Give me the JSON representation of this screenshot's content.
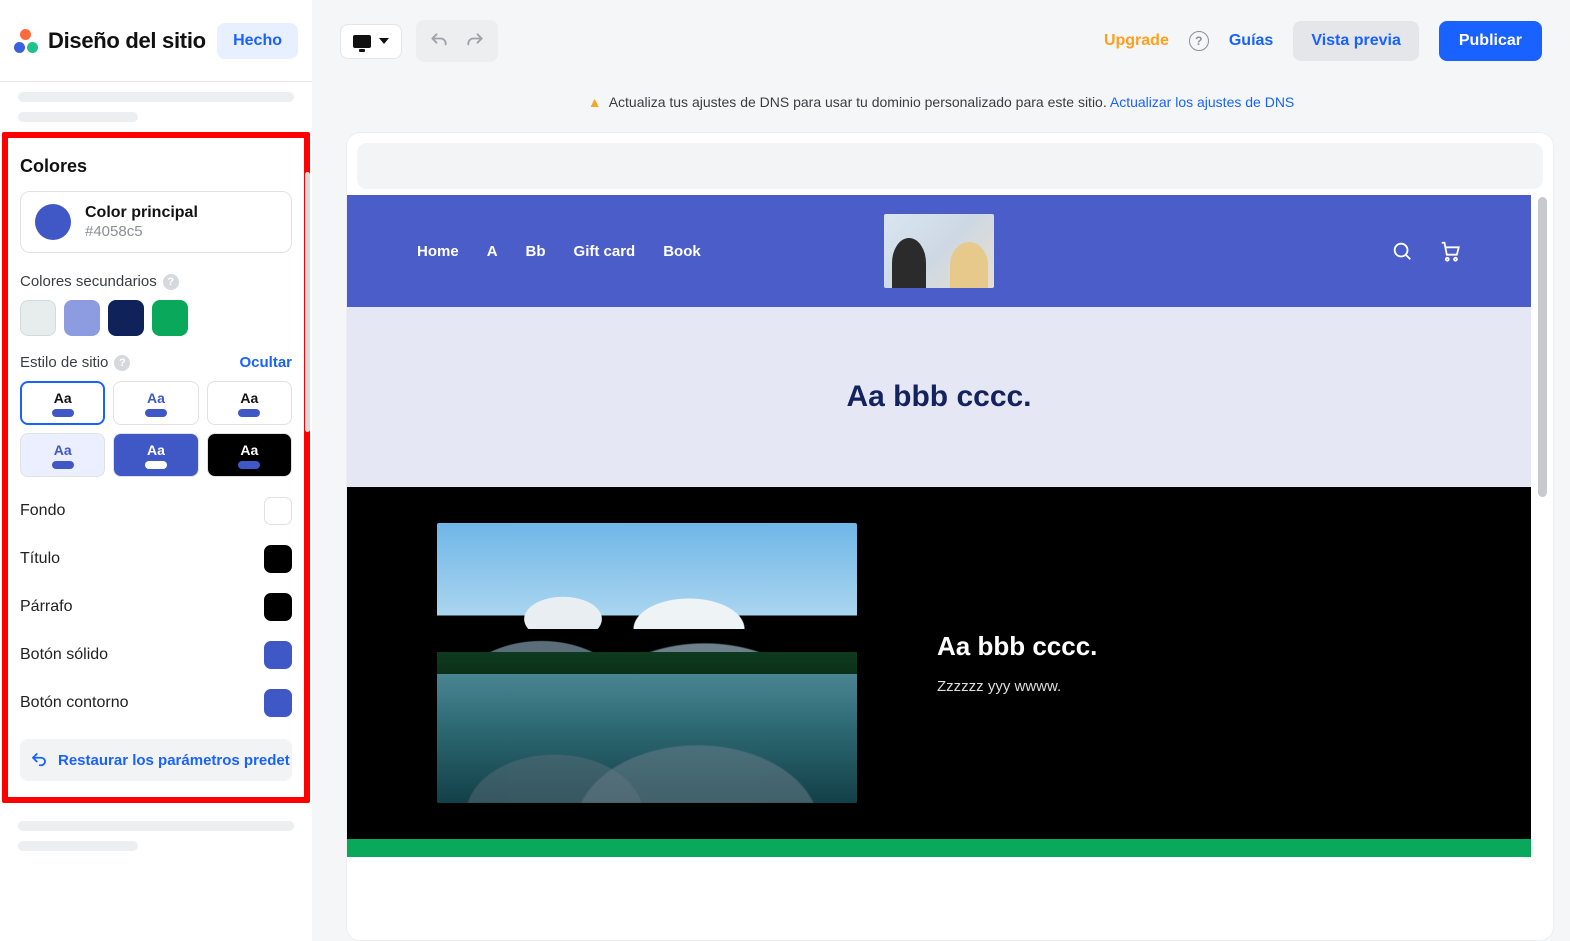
{
  "sidebar": {
    "title": "Diseño del sitio",
    "done": "Hecho",
    "colors_heading": "Colores",
    "primary": {
      "label": "Color principal",
      "value": "#4058c5"
    },
    "secondary_label": "Colores secundarios",
    "secondary_swatches": [
      "#e7edec",
      "#8d9ce0",
      "#10225a",
      "#0aa85a"
    ],
    "site_style_label": "Estilo de sitio",
    "hide_label": "Ocultar",
    "style_aa": "Aa",
    "rows": {
      "fondo": "Fondo",
      "titulo": "Título",
      "parrafo": "Párrafo",
      "boton_solido": "Botón sólido",
      "boton_contorno": "Botón contorno"
    },
    "row_colors": {
      "fondo": "#ffffff",
      "titulo": "#000000",
      "parrafo": "#000000",
      "boton_solido": "#4058c5",
      "boton_contorno": "#4058c5"
    },
    "restore": "Restaurar los parámetros predet"
  },
  "topbar": {
    "upgrade": "Upgrade",
    "guides": "Guías",
    "preview": "Vista previa",
    "publish": "Publicar"
  },
  "notice": {
    "text": "Actualiza tus ajustes de DNS para usar tu dominio personalizado para este sitio.",
    "link": "Actualizar los ajustes de DNS"
  },
  "site": {
    "nav": [
      "Home",
      "A",
      "Bb",
      "Gift card",
      "Book"
    ],
    "hero_title": "Aa bbb cccc.",
    "black_heading": "Aa bbb cccc.",
    "black_sub": "Zzzzzz yyy wwww."
  }
}
